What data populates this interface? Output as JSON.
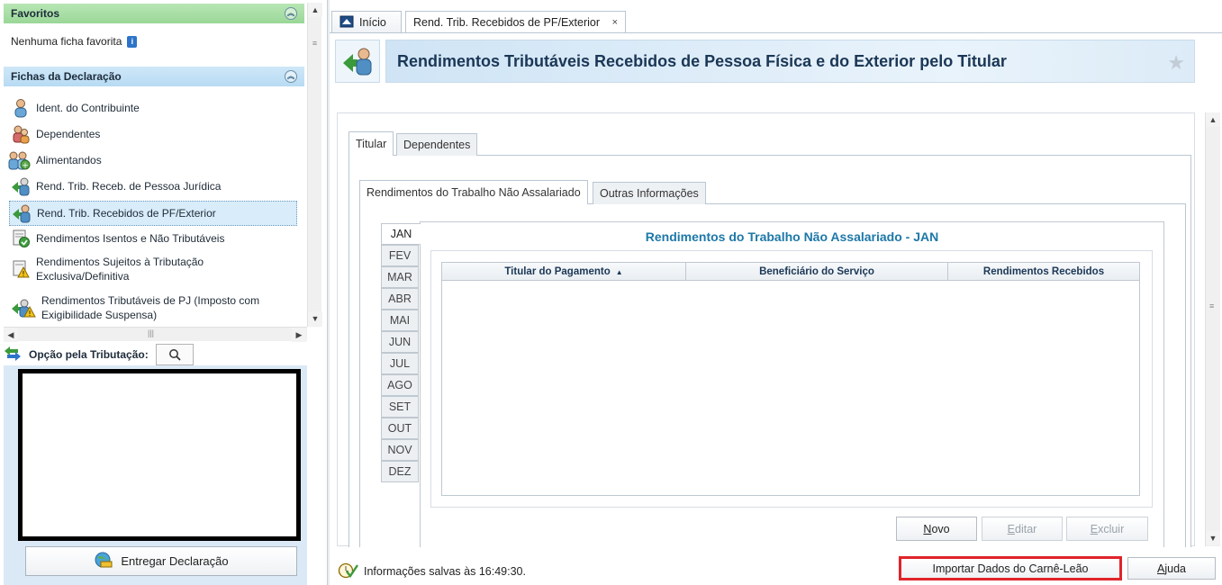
{
  "sidebar": {
    "favoritos_title": "Favoritos",
    "no_favorites": "Nenhuma ficha favorita",
    "fichas_title": "Fichas da Declaração",
    "items": [
      {
        "label": "Ident. do Contribuinte"
      },
      {
        "label": "Dependentes"
      },
      {
        "label": "Alimentandos"
      },
      {
        "label": "Rend. Trib. Receb. de Pessoa Jurídica"
      },
      {
        "label": "Rend. Trib. Recebidos de PF/Exterior"
      },
      {
        "label": "Rendimentos Isentos e Não Tributáveis"
      },
      {
        "label": "Rendimentos Sujeitos à Tributação Exclusiva/Definitiva"
      },
      {
        "label": "Rendimentos Tributáveis de PJ (Imposto com Exigibilidade Suspensa)"
      }
    ],
    "opcao_label": "Opção pela Tributação:",
    "entregar_label": "Entregar Declaração"
  },
  "tabs": {
    "inicio": "Início",
    "current": "Rend. Trib. Recebidos de PF/Exterior",
    "close": "×"
  },
  "header": {
    "title": "Rendimentos Tributáveis Recebidos de Pessoa Física e do Exterior pelo Titular",
    "star": "★"
  },
  "subtabs": {
    "titular": "Titular",
    "dependentes": "Dependentes",
    "rtna": "Rendimentos do Trabalho Não Assalariado",
    "outras": "Outras Informações"
  },
  "months": [
    "JAN",
    "FEV",
    "MAR",
    "ABR",
    "MAI",
    "JUN",
    "JUL",
    "AGO",
    "SET",
    "OUT",
    "NOV",
    "DEZ"
  ],
  "selected_month": "JAN",
  "panel": {
    "title": "Rendimentos do Trabalho Não Assalariado - JAN",
    "columns": [
      "Titular do Pagamento",
      "Beneficiário do Serviço",
      "Rendimentos Recebidos"
    ],
    "rows": []
  },
  "buttons": {
    "novo_first": "N",
    "novo_rest": "ovo",
    "editar_first": "E",
    "editar_rest": "ditar",
    "excluir_first": "E",
    "excluir_rest": "xcluir",
    "importar": "Importar Dados do Carnê-Leão",
    "ajuda_first": "A",
    "ajuda_rest": "juda"
  },
  "status": {
    "saved": "Informações salvas às 16:49:30."
  },
  "colors": {
    "favoritos_bg": "#a9dfa6",
    "fichas_bg": "#c3e1f6",
    "title_text": "#1b3756",
    "panel_title": "#1d78a8",
    "highlight_border": "#e0242a"
  },
  "icons": {
    "collapse": "double-chevron-up-icon",
    "search": "magnifier-icon",
    "entregar": "globe-send-icon",
    "status": "check-clock-icon"
  }
}
